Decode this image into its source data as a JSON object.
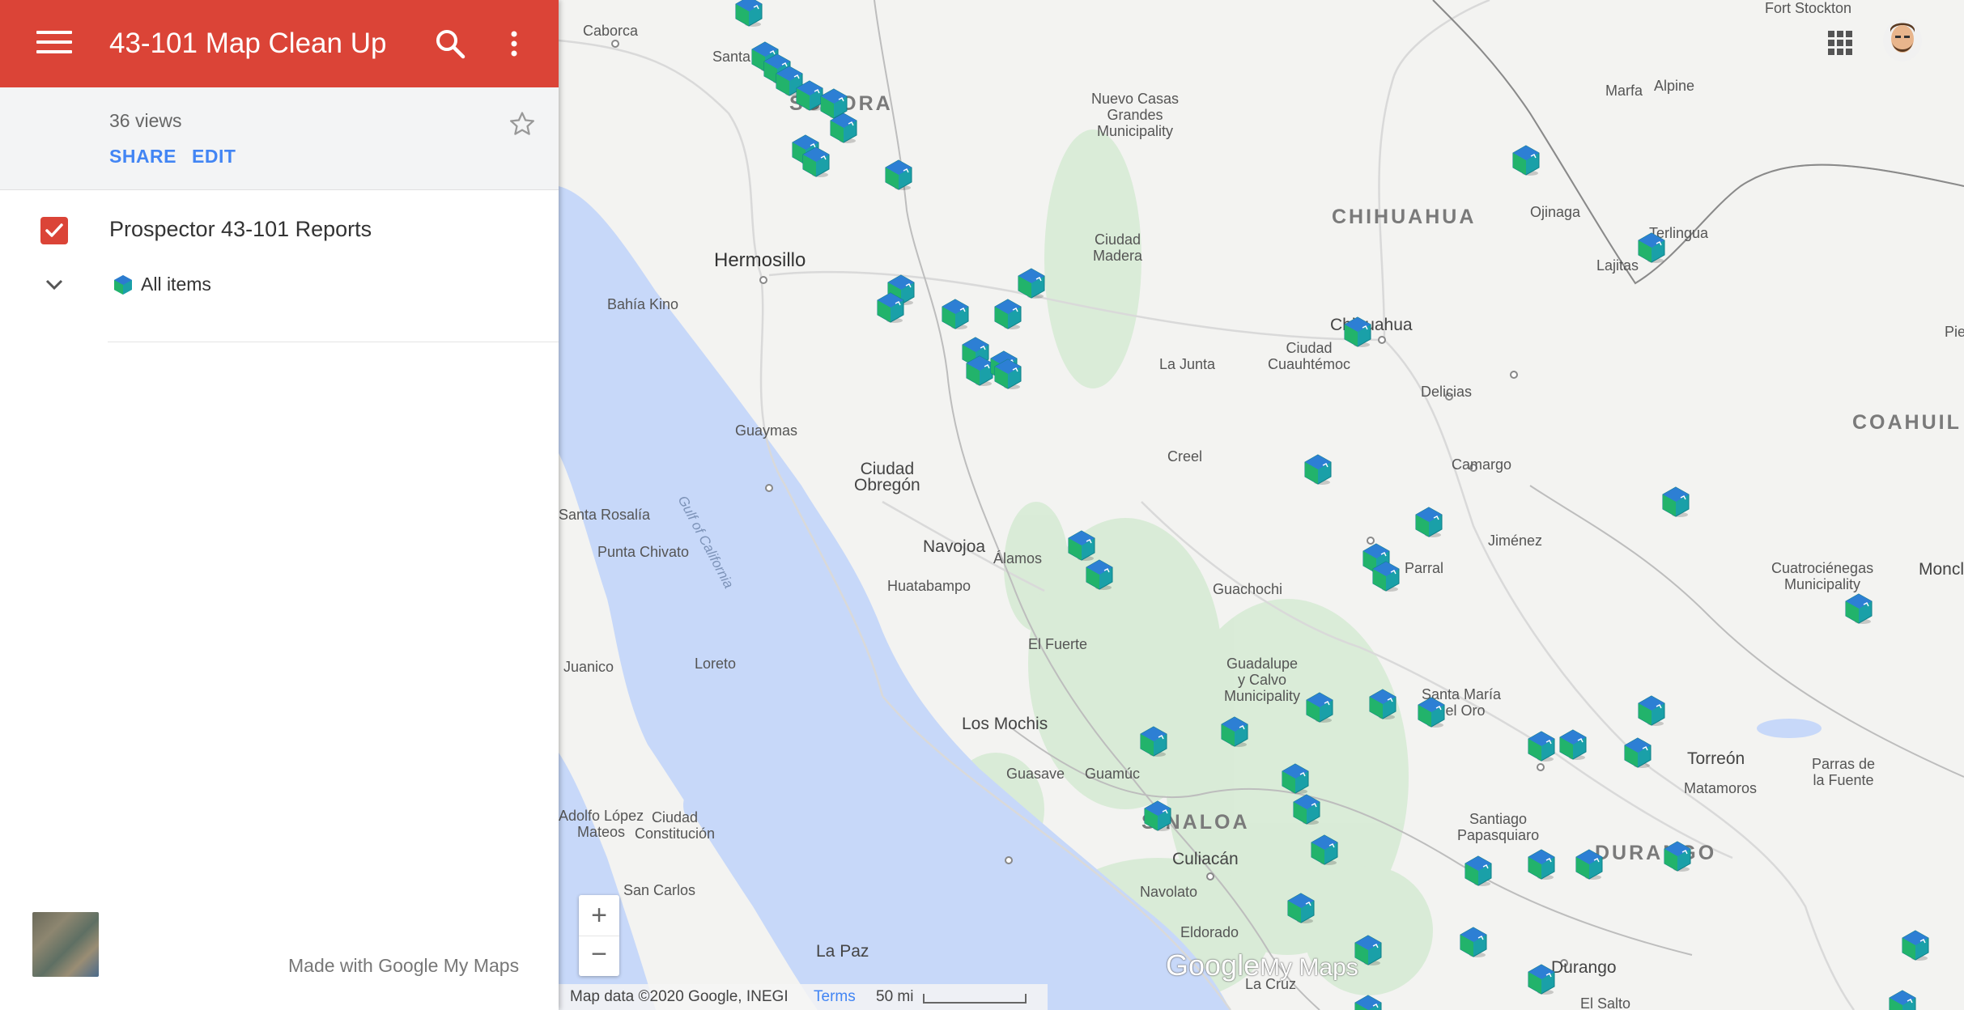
{
  "header": {
    "title": "43-101 Map Clean Up",
    "menu_icon": "menu-icon",
    "search_icon": "search-icon",
    "more_icon": "more-vert-icon",
    "color": "#db4437"
  },
  "subheader": {
    "views": "36 views",
    "share_label": "SHARE",
    "edit_label": "EDIT",
    "star_icon": "star-outline-icon"
  },
  "layer": {
    "name": "Prospector 43-101 Reports",
    "checked": true,
    "items_label": "All items"
  },
  "footer": {
    "made_with": "Made with Google My Maps"
  },
  "map": {
    "logo_google": "Google",
    "logo_mymaps": "My Maps",
    "attribution": "Map data ©2020 Google, INEGI",
    "terms": "Terms",
    "scale": "50 mi",
    "zoom_in": "+",
    "zoom_out": "−",
    "labels": {
      "caborca": "Caborca",
      "santa_ana": "Santa Ana",
      "sonora": "SONORA",
      "nuevo_casas": "Nuevo Casas\nGrandes\nMunicipality",
      "chihuahua_state": "CHIHUAHUA",
      "marfa": "Marfa",
      "alpine": "Alpine",
      "fort_stockton": "Fort Stockton",
      "ojinaga": "Ojinaga",
      "terlingua": "Terlingua",
      "lajitas": "Lajitas",
      "hermosillo": "Hermosillo",
      "bahia_kino": "Bahía Kino",
      "ciudad_madera": "Ciudad\nMadera",
      "chihuahua_city": "Chihuahua",
      "ciudad_cuauhtemoc": "Ciudad\nCuauhtémoc",
      "la_junta": "La Junta",
      "delicias": "Delicias",
      "coahuila": "COAHUIL",
      "guaymas": "Guaymas",
      "ciudad_obregon": "Ciudad\nObregón",
      "creel": "Creel",
      "camargo": "Camargo",
      "santa_rosalia": "Santa Rosalía",
      "punta_chivato": "Punta Chivato",
      "gulf": "Gulf of California",
      "navojoa": "Navojoa",
      "alamos": "Álamos",
      "jimenez": "Jiménez",
      "huatabampo": "Huatabampo",
      "guachochi": "Guachochi",
      "parral": "Parral",
      "cuatrocienegas": "Cuatrociénegas\nMunicipality",
      "monclova": "Moncl",
      "el_fuerte": "El Fuerte",
      "juanico": "Juanico",
      "loreto": "Loreto",
      "guadalupe_calvo": "Guadalupe\ny Calvo\nMunicipality",
      "santa_maria_oro": "Santa María\ndel Oro",
      "los_mochis": "Los Mochis",
      "guasave": "Guasave",
      "guamuchil": "Guamúc",
      "torreon": "Torreón",
      "matamoros": "Matamoros",
      "parras": "Parras de\nla Fuente",
      "adolfo_lopez": "Adolfo López\nMateos",
      "ciudad_constitucion": "Ciudad\nConstitución",
      "sinaloa": "SINALOA",
      "santiago_papasquiaro": "Santiago\nPapasquiaro",
      "durango_state": "DURANGO",
      "culiacan": "Culiacán",
      "navolato": "Navolato",
      "san_carlos": "San Carlos",
      "eldorado": "Eldorado",
      "la_paz": "La Paz",
      "durango_city": "Durango",
      "la_cruz": "La Cruz",
      "el_salto": "El Salto",
      "pie": "Pie"
    }
  },
  "colors": {
    "accent": "#db4437",
    "link": "#4285f4",
    "water": "#c7d8f9",
    "land": "#f3f3f1",
    "vegetation": "#d4ead4",
    "marker": "#1fa3a3"
  }
}
